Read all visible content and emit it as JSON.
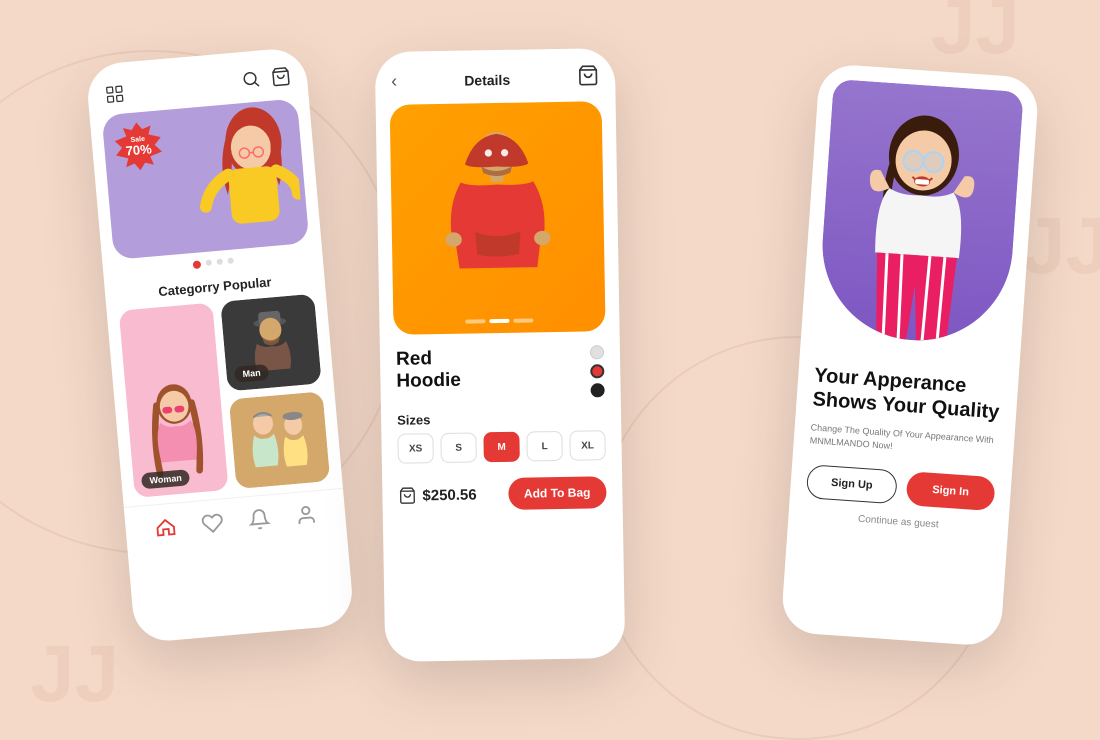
{
  "background": {
    "color": "#f5d9c8"
  },
  "phone1": {
    "header": {
      "menu_icon": "grid-icon",
      "search_icon": "search-icon",
      "cart_icon": "cart-icon"
    },
    "banner": {
      "sale_label": "Sale",
      "sale_percent": "70%"
    },
    "section_title": "Categorry Popular",
    "categories": [
      {
        "id": "woman",
        "label": "Woman",
        "bg": "#f8bbd0"
      },
      {
        "id": "man",
        "label": "Man",
        "bg": "#424242"
      },
      {
        "id": "kids",
        "label": "",
        "bg": "#d4a76a"
      },
      {
        "id": "extra",
        "label": "",
        "bg": "#f5e6c8"
      }
    ],
    "nav": {
      "items": [
        "home",
        "favorite",
        "notification",
        "profile"
      ]
    }
  },
  "phone2": {
    "header": {
      "back_label": "‹",
      "title": "Details",
      "cart_icon": "cart-icon"
    },
    "product": {
      "name_line1": "Red",
      "name_line2": "Hoodie",
      "price": "$250.56",
      "add_to_bag": "Add To Bag"
    },
    "sizes": {
      "label": "Sizes",
      "options": [
        "XS",
        "S",
        "M",
        "L",
        "XL"
      ],
      "selected": "M"
    },
    "colors": [
      "#e0e0e0",
      "#e53935",
      "#212121"
    ]
  },
  "phone3": {
    "main_title": "Your Apperance\nShows Your Quality",
    "sub_text": "Change The Quality Of Your Appearance With MNMLMANDO Now!",
    "signup_label": "Sign Up",
    "signin_label": "Sign In",
    "guest_label": "Continue as guest"
  }
}
